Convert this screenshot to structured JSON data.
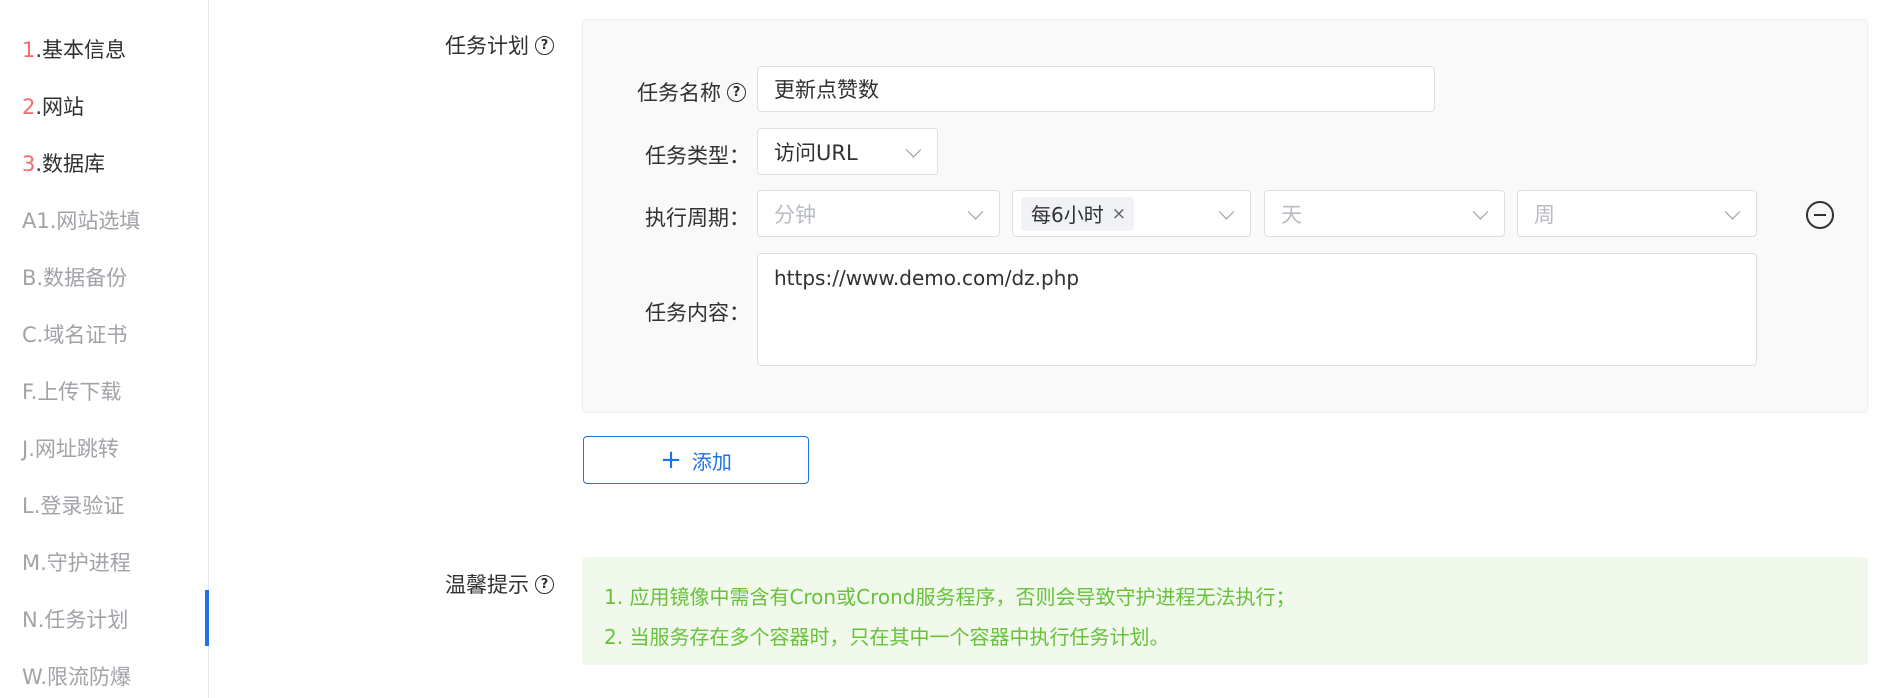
{
  "sidebar": {
    "items": [
      {
        "num": "1",
        "label": ".基本信息"
      },
      {
        "num": "2",
        "label": ".网站"
      },
      {
        "num": "3",
        "label": ".数据库"
      },
      {
        "label": "A1.网站选填"
      },
      {
        "label": "B.数据备份"
      },
      {
        "label": "C.域名证书"
      },
      {
        "label": "F.上传下载"
      },
      {
        "label": "J.网址跳转"
      },
      {
        "label": "L.登录验证"
      },
      {
        "label": "M.守护进程"
      },
      {
        "label": "N.任务计划"
      },
      {
        "label": "W.限流防爆"
      }
    ],
    "active_index": 10
  },
  "form": {
    "section_label": "任务计划",
    "task_name_label": "任务名称",
    "task_name_value": "更新点赞数",
    "task_type_label": "任务类型：",
    "task_type_value": "访问URL",
    "cycle_label": "执行周期：",
    "cycle_minute_placeholder": "分钟",
    "cycle_hour_tag": "每6小时",
    "cycle_day_placeholder": "天",
    "cycle_week_placeholder": "周",
    "content_label": "任务内容：",
    "content_value": "https://www.demo.com/dz.php",
    "add_icon": "+",
    "add_label": "添加"
  },
  "tips": {
    "label": "温馨提示",
    "lines": [
      "1. 应用镜像中需含有Cron或Crond服务程序，否则会导致守护进程无法执行；",
      "2. 当服务存在多个容器时，只在其中一个容器中执行任务计划。"
    ]
  },
  "icons": {
    "help": "question-circle-icon",
    "remove": "minus-circle-icon",
    "chevron": "chevron-down-icon",
    "close": "close-icon"
  },
  "colors": {
    "accent": "#1a73e8",
    "number_red": "#f56c6c",
    "tip_green": "#67c23a",
    "tip_bg": "#f0f9eb"
  }
}
